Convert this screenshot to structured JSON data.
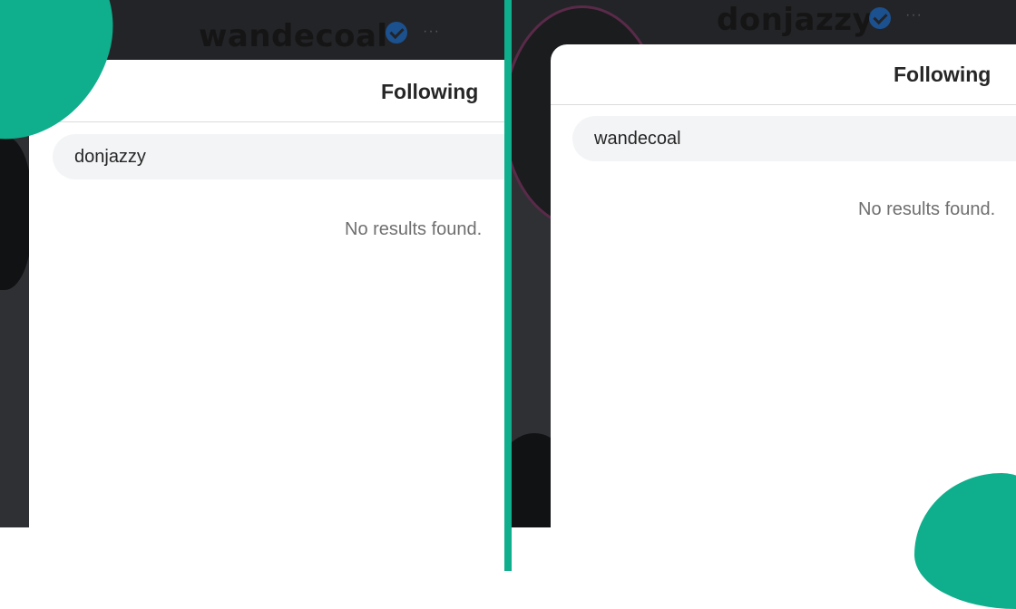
{
  "left_panel": {
    "profile_username": "wandecoal",
    "more_icon": "···",
    "modal_title": "Following",
    "search_value": "donjazzy",
    "empty_message": "No results found."
  },
  "right_panel": {
    "profile_username": "donjazzy",
    "more_icon": "···",
    "modal_title": "Following",
    "search_value": "wandecoal",
    "empty_message": "No results found."
  },
  "colors": {
    "accent": "#0fae8c",
    "verified": "#1877e5",
    "backdrop": "#2f3034"
  },
  "icons": [
    "verified-badge-icon",
    "more-options-icon"
  ]
}
